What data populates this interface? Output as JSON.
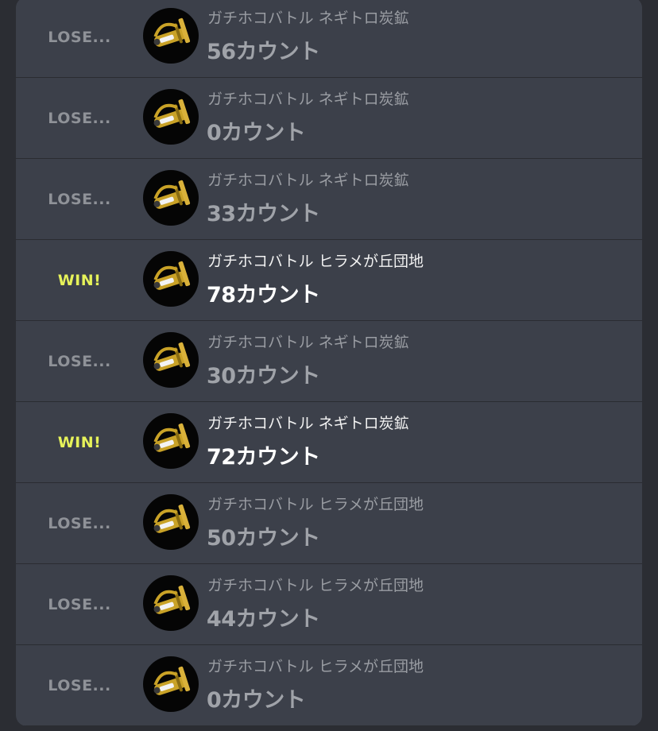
{
  "colors": {
    "win_text": "#e6f25a",
    "lose_text": "#8f9298",
    "panel": "#3c404a",
    "background": "#2b2d33"
  },
  "weapon_icon": "rainmaker-weapon-icon",
  "matches": [
    {
      "result": "LOSE...",
      "mode": "ガチホコバトル",
      "stage": "ネギトロ炭鉱",
      "count": "56カウント",
      "won": false
    },
    {
      "result": "LOSE...",
      "mode": "ガチホコバトル",
      "stage": "ネギトロ炭鉱",
      "count": "0カウント",
      "won": false
    },
    {
      "result": "LOSE...",
      "mode": "ガチホコバトル",
      "stage": "ネギトロ炭鉱",
      "count": "33カウント",
      "won": false
    },
    {
      "result": "WIN!",
      "mode": "ガチホコバトル",
      "stage": "ヒラメが丘団地",
      "count": "78カウント",
      "won": true
    },
    {
      "result": "LOSE...",
      "mode": "ガチホコバトル",
      "stage": "ネギトロ炭鉱",
      "count": "30カウント",
      "won": false
    },
    {
      "result": "WIN!",
      "mode": "ガチホコバトル",
      "stage": "ネギトロ炭鉱",
      "count": "72カウント",
      "won": true
    },
    {
      "result": "LOSE...",
      "mode": "ガチホコバトル",
      "stage": "ヒラメが丘団地",
      "count": "50カウント",
      "won": false
    },
    {
      "result": "LOSE...",
      "mode": "ガチホコバトル",
      "stage": "ヒラメが丘団地",
      "count": "44カウント",
      "won": false
    },
    {
      "result": "LOSE...",
      "mode": "ガチホコバトル",
      "stage": "ヒラメが丘団地",
      "count": "0カウント",
      "won": false
    }
  ]
}
